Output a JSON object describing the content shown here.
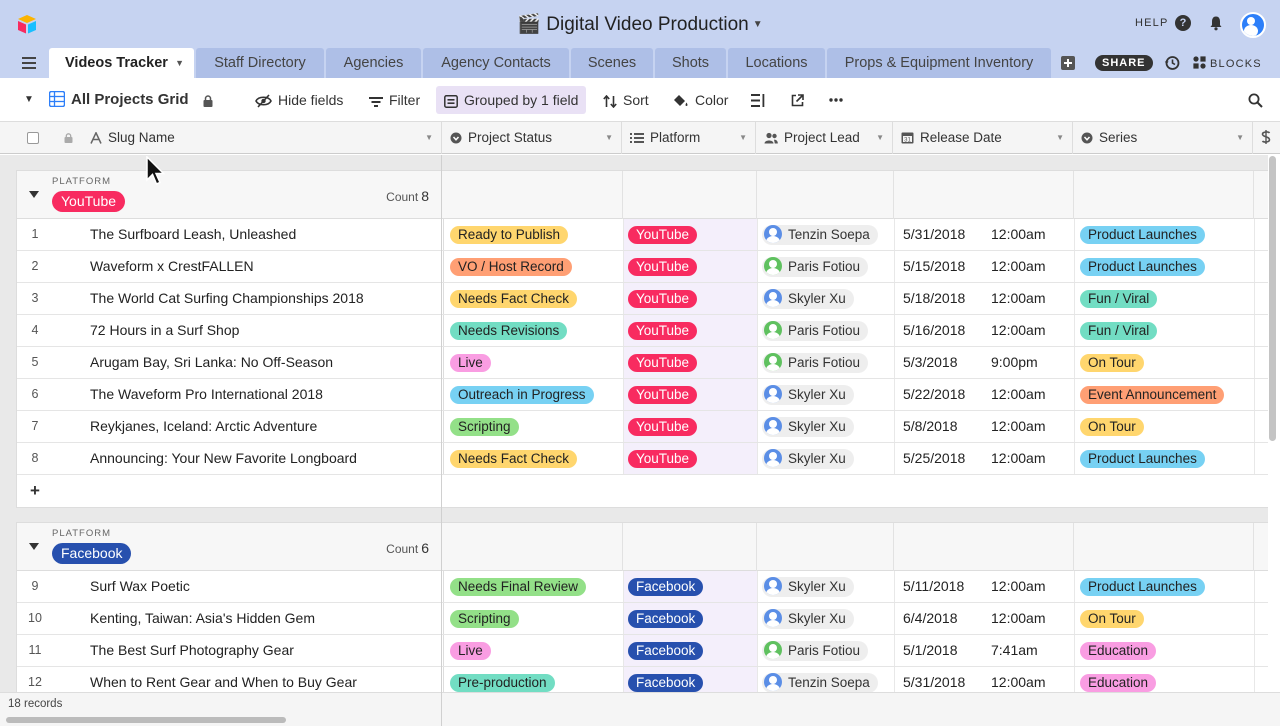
{
  "app": {
    "base_name": "🎬 Digital Video Production",
    "help_label": "HELP",
    "share_label": "SHARE",
    "blocks_label": "BLOCKS"
  },
  "tabs": [
    {
      "label": "Videos Tracker",
      "active": true
    },
    {
      "label": "Staff Directory"
    },
    {
      "label": "Agencies"
    },
    {
      "label": "Agency Contacts"
    },
    {
      "label": "Scenes"
    },
    {
      "label": "Shots"
    },
    {
      "label": "Locations"
    },
    {
      "label": "Props & Equipment Inventory"
    }
  ],
  "viewbar": {
    "view_name": "All Projects Grid",
    "hide_fields": "Hide fields",
    "filter": "Filter",
    "grouped": "Grouped by 1 field",
    "sort": "Sort",
    "color": "Color"
  },
  "columns": {
    "slug": "Slug Name",
    "status": "Project Status",
    "platform": "Platform",
    "lead": "Project Lead",
    "release": "Release Date",
    "series": "Series"
  },
  "colors": {
    "youtube": "#f82b60",
    "facebook": "#2750ae",
    "status": {
      "Ready to Publish": "#ffd66e",
      "VO / Host Record": "#ff9f74",
      "Needs Fact Check": "#ffd66e",
      "Needs Revisions": "#72ddc3",
      "Live": "#f99de2",
      "Outreach in Progress": "#77d1f3",
      "Scripting": "#93e088",
      "Needs Final Review": "#93e088",
      "Pre-production": "#72ddc3"
    },
    "series": {
      "Product Launches": "#77d1f3",
      "Fun / Viral": "#72ddc3",
      "On Tour": "#ffd66e",
      "Event Announcement": "#ff9f74",
      "Education": "#f99de2"
    },
    "lead": {
      "Tenzin Soepa": "#5b8ee6",
      "Paris Fotiou": "#5fc15f",
      "Skyler Xu": "#5b8ee6"
    }
  },
  "groups": [
    {
      "label": "PLATFORM",
      "name": "YouTube",
      "count_label": "Count",
      "count": "8",
      "rows": [
        {
          "n": "1",
          "slug": "The Surfboard Leash, Unleashed",
          "status": "Ready to Publish",
          "platform": "YouTube",
          "lead": "Tenzin Soepa",
          "date": "5/31/2018",
          "time": "12:00am",
          "series": "Product Launches"
        },
        {
          "n": "2",
          "slug": "Waveform x CrestFALLEN",
          "status": "VO / Host Record",
          "platform": "YouTube",
          "lead": "Paris Fotiou",
          "date": "5/15/2018",
          "time": "12:00am",
          "series": "Product Launches"
        },
        {
          "n": "3",
          "slug": "The World Cat Surfing Championships 2018",
          "status": "Needs Fact Check",
          "platform": "YouTube",
          "lead": "Skyler Xu",
          "date": "5/18/2018",
          "time": "12:00am",
          "series": "Fun / Viral"
        },
        {
          "n": "4",
          "slug": "72 Hours in a Surf Shop",
          "status": "Needs Revisions",
          "platform": "YouTube",
          "lead": "Paris Fotiou",
          "date": "5/16/2018",
          "time": "12:00am",
          "series": "Fun / Viral"
        },
        {
          "n": "5",
          "slug": "Arugam Bay, Sri Lanka: No Off-Season",
          "status": "Live",
          "platform": "YouTube",
          "lead": "Paris Fotiou",
          "date": "5/3/2018",
          "time": "9:00pm",
          "series": "On Tour"
        },
        {
          "n": "6",
          "slug": "The Waveform Pro International 2018",
          "status": "Outreach in Progress",
          "platform": "YouTube",
          "lead": "Skyler Xu",
          "date": "5/22/2018",
          "time": "12:00am",
          "series": "Event Announcement"
        },
        {
          "n": "7",
          "slug": "Reykjanes, Iceland: Arctic Adventure",
          "status": "Scripting",
          "platform": "YouTube",
          "lead": "Skyler Xu",
          "date": "5/8/2018",
          "time": "12:00am",
          "series": "On Tour"
        },
        {
          "n": "8",
          "slug": "Announcing: Your New Favorite Longboard",
          "status": "Needs Fact Check",
          "platform": "YouTube",
          "lead": "Skyler Xu",
          "date": "5/25/2018",
          "time": "12:00am",
          "series": "Product Launches"
        }
      ]
    },
    {
      "label": "PLATFORM",
      "name": "Facebook",
      "count_label": "Count",
      "count": "6",
      "rows": [
        {
          "n": "9",
          "slug": "Surf Wax Poetic",
          "status": "Needs Final Review",
          "platform": "Facebook",
          "lead": "Skyler Xu",
          "date": "5/11/2018",
          "time": "12:00am",
          "series": "Product Launches"
        },
        {
          "n": "10",
          "slug": "Kenting, Taiwan: Asia's Hidden Gem",
          "status": "Scripting",
          "platform": "Facebook",
          "lead": "Skyler Xu",
          "date": "6/4/2018",
          "time": "12:00am",
          "series": "On Tour"
        },
        {
          "n": "11",
          "slug": "The Best Surf Photography Gear",
          "status": "Live",
          "platform": "Facebook",
          "lead": "Paris Fotiou",
          "date": "5/1/2018",
          "time": "7:41am",
          "series": "Education"
        },
        {
          "n": "12",
          "slug": "When to Rent Gear and When to Buy Gear",
          "status": "Pre-production",
          "platform": "Facebook",
          "lead": "Tenzin Soepa",
          "date": "5/31/2018",
          "time": "12:00am",
          "series": "Education"
        }
      ]
    }
  ],
  "footer": {
    "records": "18 records"
  }
}
